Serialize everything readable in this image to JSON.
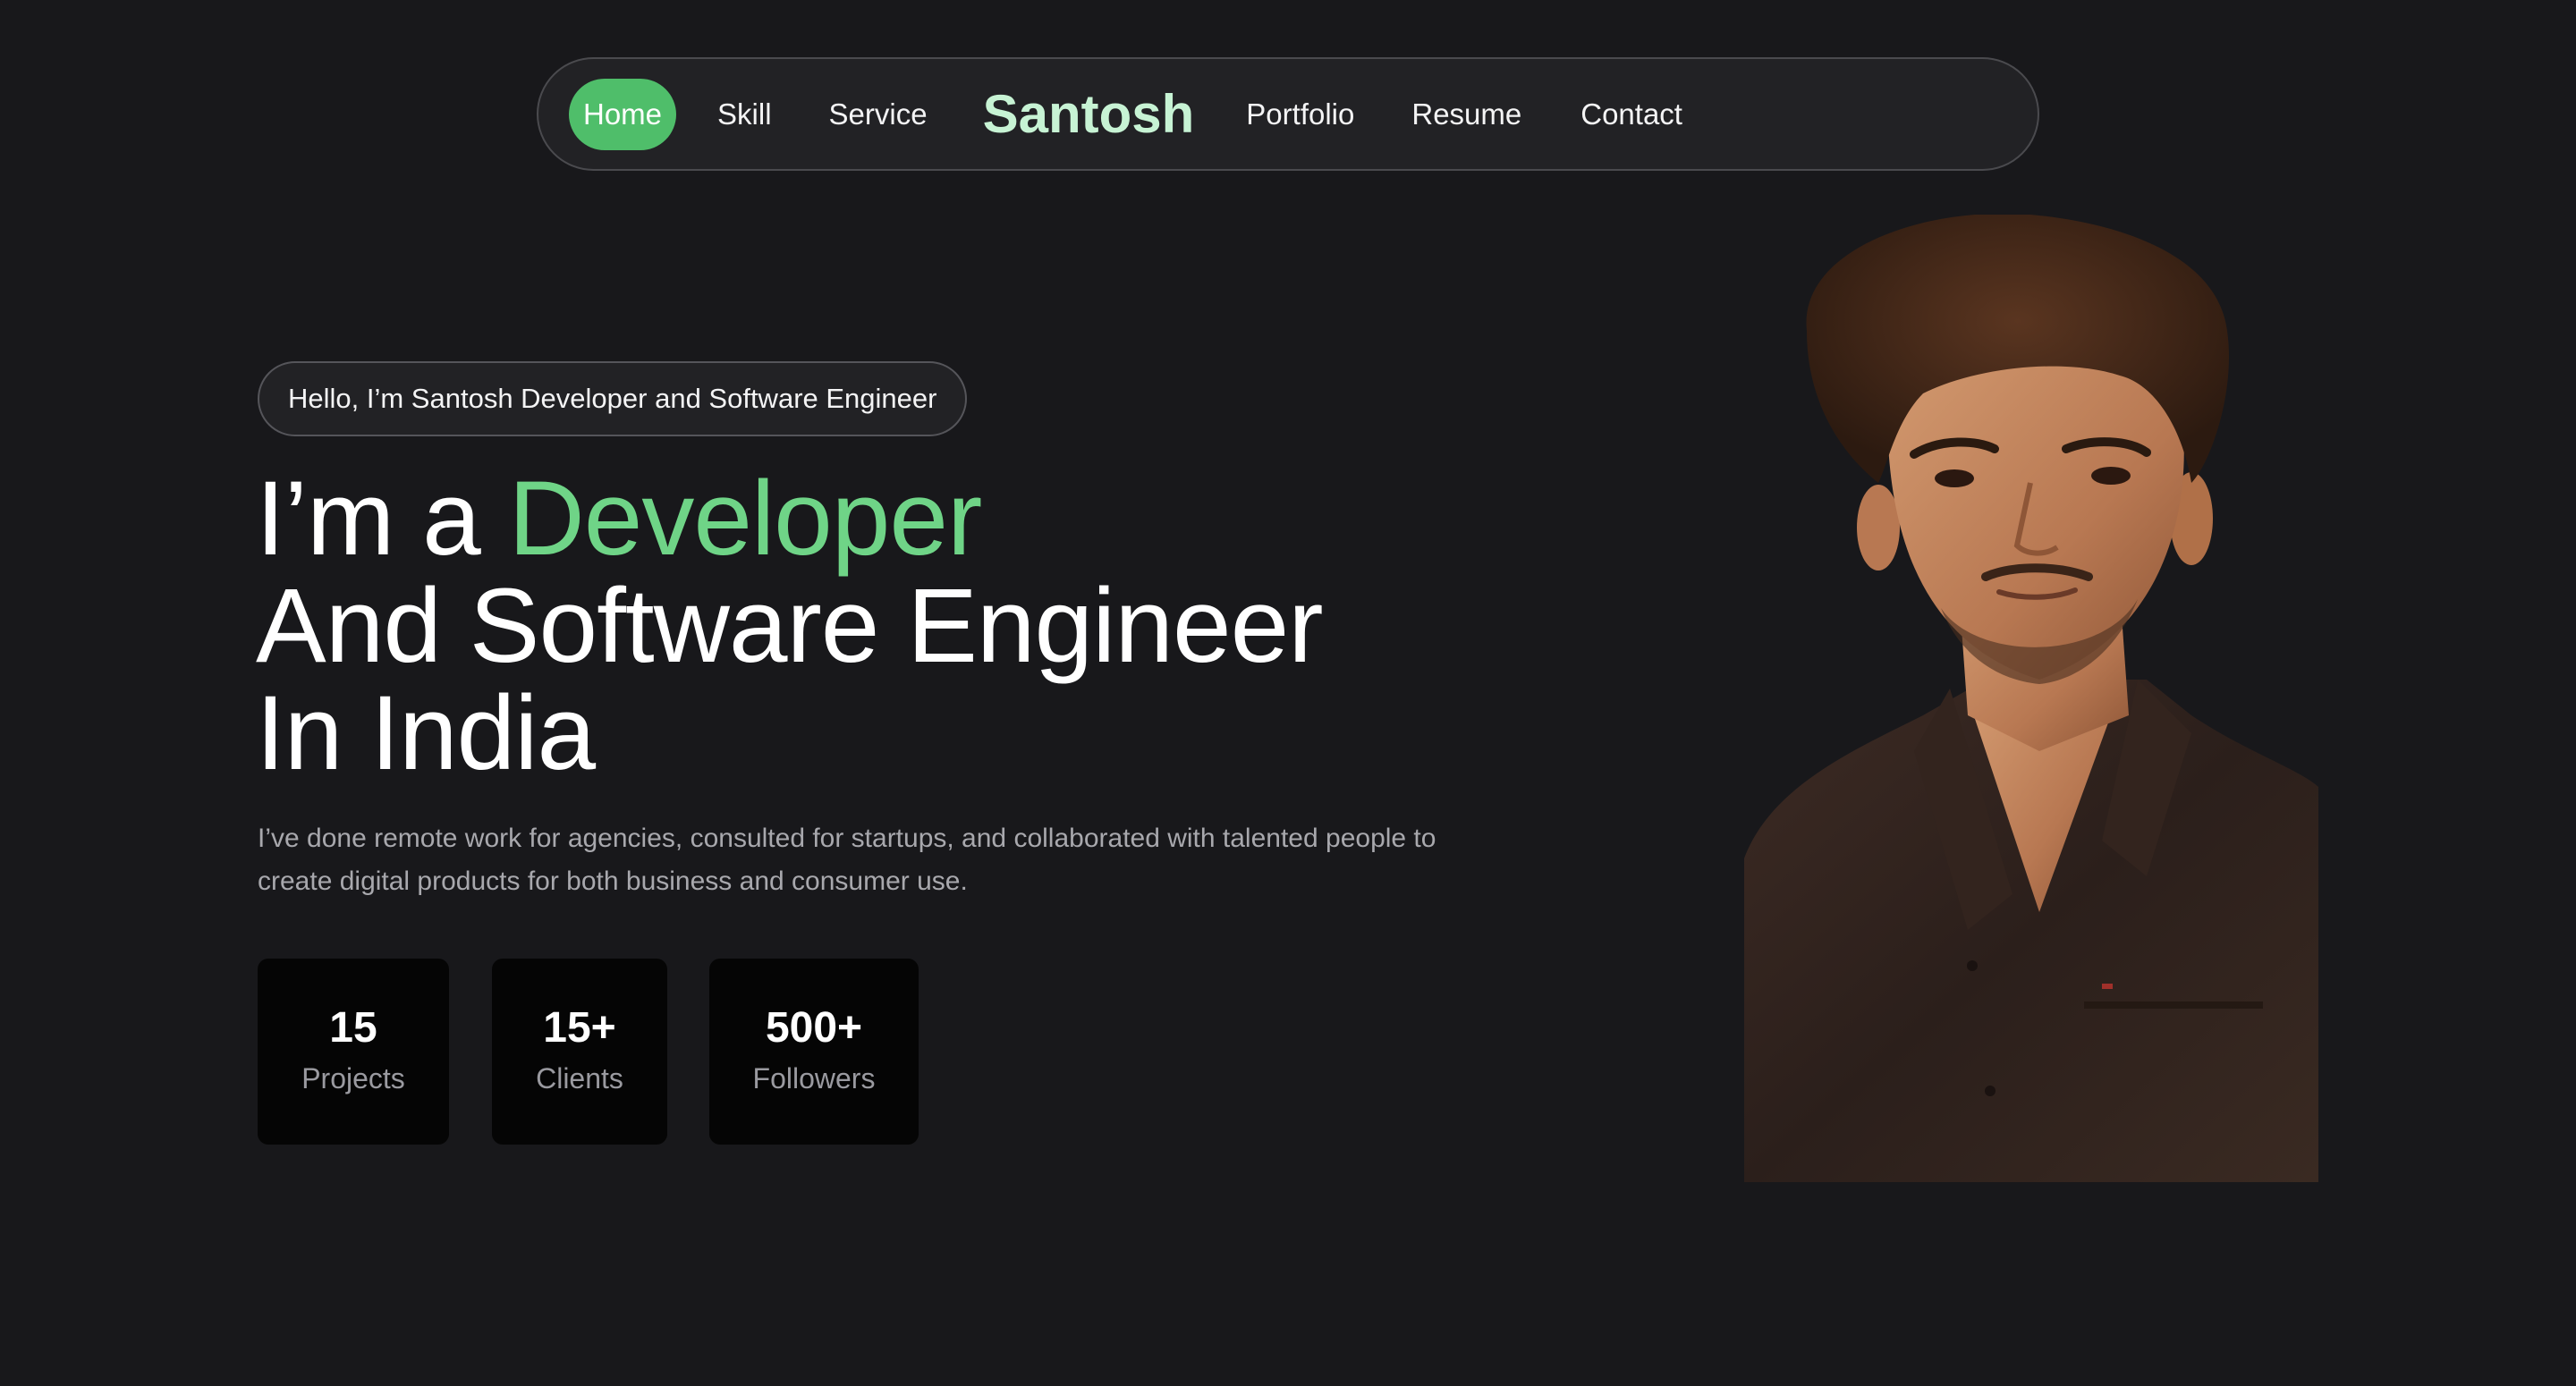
{
  "nav": {
    "items": [
      "Home",
      "Skill",
      "Service"
    ],
    "brand": "Santosh",
    "items_right": [
      "Portfolio",
      "Resume",
      "Contact"
    ],
    "active": "Home",
    "accent_color": "#4fbe6a"
  },
  "hero": {
    "tagline": "Hello, I’m Santosh Developer and Software Engineer",
    "heading_prefix": "I’m a ",
    "heading_accent": "Developer",
    "heading_line2": "And Software Engineer",
    "heading_line3": "In India",
    "description": "I’ve done remote work for agencies, consulted for startups, and collaborated with talented people to create digital products for both business and consumer use.",
    "accent_color": "#6fd487"
  },
  "stats": [
    {
      "value": "15",
      "label": "Projects"
    },
    {
      "value": "15+",
      "label": "Clients"
    },
    {
      "value": "500+",
      "label": "Followers"
    }
  ],
  "portrait": {
    "subject": "profile-photo"
  }
}
